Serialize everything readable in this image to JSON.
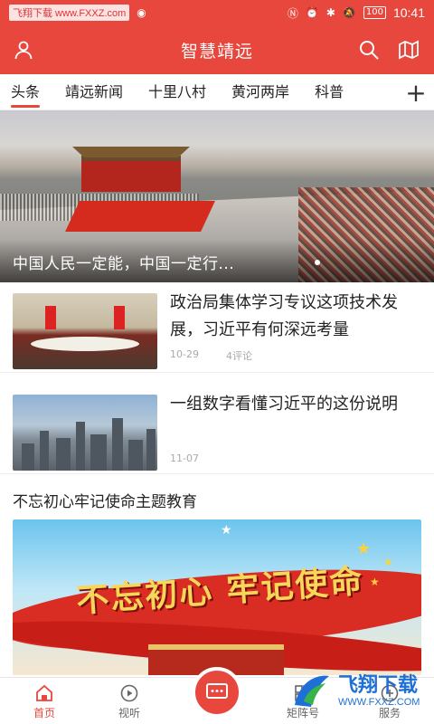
{
  "statusbar": {
    "site": "飞翔下载 www.FXXZ.com",
    "battery": "100",
    "time": "10:41"
  },
  "header": {
    "title": "智慧靖远"
  },
  "tabs": [
    {
      "label": "头条",
      "active": true
    },
    {
      "label": "靖远新闻",
      "active": false
    },
    {
      "label": "十里八村",
      "active": false
    },
    {
      "label": "黄河两岸",
      "active": false
    },
    {
      "label": "科普",
      "active": false
    }
  ],
  "hero": {
    "caption": "中国人民一定能，中国一定行..."
  },
  "news": [
    {
      "title": "政治局集体学习专议这项技术发展，习近平有何深远考量",
      "date": "10-29",
      "comments": "4评论"
    },
    {
      "title": "一组数字看懂习近平的这份说明",
      "date": "11-07",
      "comments": ""
    }
  ],
  "section": {
    "title": "不忘初心牢记使命主题教育",
    "banner_text": "不忘初心 牢记使命"
  },
  "bottomnav": {
    "home": "首页",
    "video": "视听",
    "item4": "矩阵号",
    "item5": "服务"
  },
  "watermark": {
    "brand": "飞翔下载",
    "url": "WWW.FXXZ.COM"
  },
  "colors": {
    "brand": "#e8473d"
  }
}
